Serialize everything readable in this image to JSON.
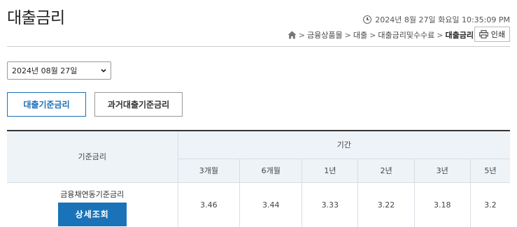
{
  "page": {
    "title": "대출금리"
  },
  "header": {
    "datetime": "2024년 8월 27일 화요일 10:35:09 PM",
    "breadcrumb": [
      "금융상품몰",
      "대출",
      "대출금리및수수료",
      "대출금리"
    ],
    "print_label": "인쇄"
  },
  "filter": {
    "date_value": "2024년 08월 27일"
  },
  "tabs": [
    {
      "label": "대출기준금리",
      "active": true
    },
    {
      "label": "과거대출기준금리",
      "active": false
    }
  ],
  "table": {
    "base_header": "기준금리",
    "period_header": "기간",
    "periods": [
      "3개월",
      "6개월",
      "1년",
      "2년",
      "3년",
      "5년"
    ],
    "rows": [
      {
        "name": "금융채연동기준금리",
        "button_label": "상세조회",
        "values": [
          "3.46",
          "3.44",
          "3.33",
          "3.22",
          "3.18",
          "3.2"
        ]
      }
    ]
  },
  "colors": {
    "accent": "#1a73b8",
    "header_bg": "#eef3f8"
  }
}
